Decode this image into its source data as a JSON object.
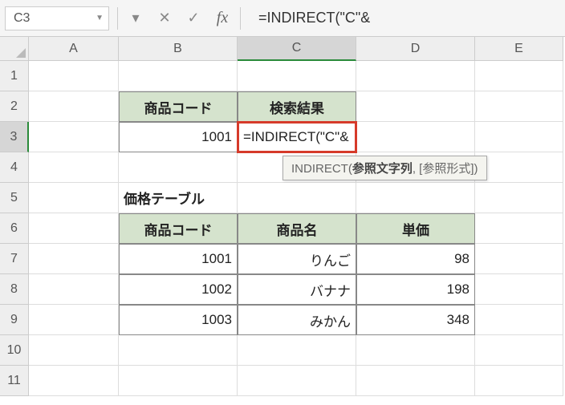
{
  "name_box": "C3",
  "formula_bar": "=INDIRECT(\"C\"&",
  "columns": [
    "A",
    "B",
    "C",
    "D",
    "E"
  ],
  "active_col": "C",
  "rows": [
    "1",
    "2",
    "3",
    "4",
    "5",
    "6",
    "7",
    "8",
    "9",
    "10",
    "11"
  ],
  "active_row": "3",
  "section1": {
    "headers": {
      "b": "商品コード",
      "c": "検索結果"
    },
    "b3": "1001",
    "c3": "=INDIRECT(\"C\"&"
  },
  "section2_title": "価格テーブル",
  "section2": {
    "headers": {
      "b": "商品コード",
      "c": "商品名",
      "d": "単価"
    },
    "rows": [
      {
        "code": "1001",
        "name": "りんご",
        "price": "98"
      },
      {
        "code": "1002",
        "name": "バナナ",
        "price": "198"
      },
      {
        "code": "1003",
        "name": "みかん",
        "price": "348"
      }
    ]
  },
  "tooltip": {
    "fn": "INDIRECT(",
    "arg1": "参照文字列",
    "rest": ", [参照形式])"
  }
}
